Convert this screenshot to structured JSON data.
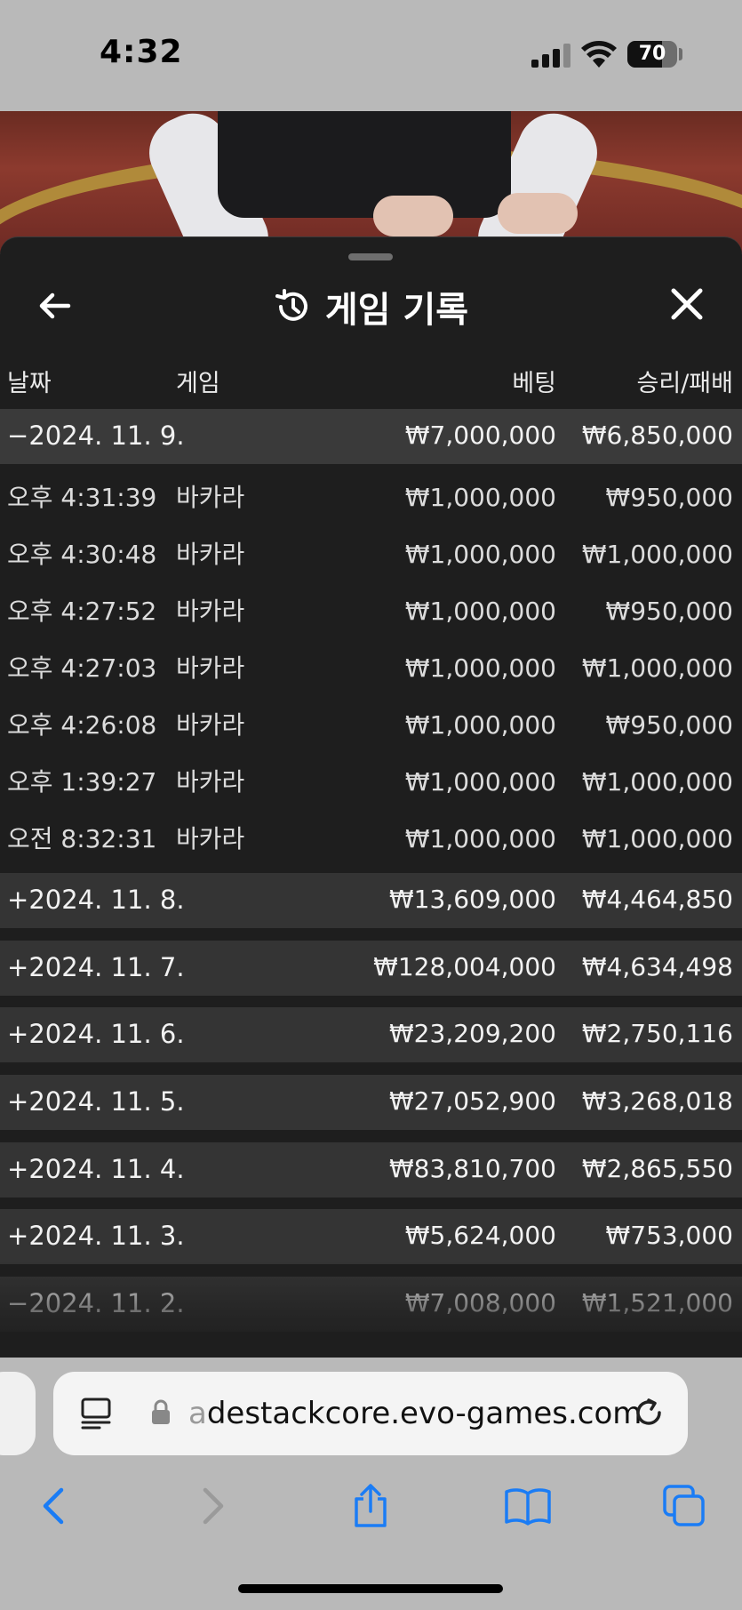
{
  "status_bar": {
    "time": "4:32",
    "battery": "70",
    "battery_level": 0.7
  },
  "panel": {
    "title": "게임 기록"
  },
  "columns": {
    "date": "날짜",
    "game": "게임",
    "bet": "베팅",
    "win_loss": "승리/패배"
  },
  "groups": [
    {
      "toggle": "−",
      "date": "2024. 11. 9.",
      "bet": "₩7,000,000",
      "win": "₩6,850,000",
      "expanded": true,
      "rows": [
        {
          "time": "오후 4:31:39",
          "game": "바카라",
          "bet": "₩1,000,000",
          "win": "₩950,000"
        },
        {
          "time": "오후 4:30:48",
          "game": "바카라",
          "bet": "₩1,000,000",
          "win": "₩1,000,000"
        },
        {
          "time": "오후 4:27:52",
          "game": "바카라",
          "bet": "₩1,000,000",
          "win": "₩950,000"
        },
        {
          "time": "오후 4:27:03",
          "game": "바카라",
          "bet": "₩1,000,000",
          "win": "₩1,000,000"
        },
        {
          "time": "오후 4:26:08",
          "game": "바카라",
          "bet": "₩1,000,000",
          "win": "₩950,000"
        },
        {
          "time": "오후 1:39:27",
          "game": "바카라",
          "bet": "₩1,000,000",
          "win": "₩1,000,000"
        },
        {
          "time": "오전 8:32:31",
          "game": "바카라",
          "bet": "₩1,000,000",
          "win": "₩1,000,000"
        }
      ]
    },
    {
      "toggle": "+",
      "date": "2024. 11. 8.",
      "bet": "₩13,609,000",
      "win": "₩4,464,850"
    },
    {
      "toggle": "+",
      "date": "2024. 11. 7.",
      "bet": "₩128,004,000",
      "win": "₩4,634,498"
    },
    {
      "toggle": "+",
      "date": "2024. 11. 6.",
      "bet": "₩23,209,200",
      "win": "₩2,750,116"
    },
    {
      "toggle": "+",
      "date": "2024. 11. 5.",
      "bet": "₩27,052,900",
      "win": "₩3,268,018"
    },
    {
      "toggle": "+",
      "date": "2024. 11. 4.",
      "bet": "₩83,810,700",
      "win": "₩2,865,550"
    },
    {
      "toggle": "+",
      "date": "2024. 11. 3.",
      "bet": "₩5,624,000",
      "win": "₩753,000"
    },
    {
      "toggle": "−",
      "date": "2024. 11. 2.",
      "bet": "₩7,008,000",
      "win": "₩1,521,000"
    }
  ],
  "browser": {
    "url_faded": "a",
    "url": "destackcore.evo-games.com"
  },
  "colors": {
    "panel_bg": "#1e1e1e",
    "row_header_bg": "#343434",
    "accent_blue": "#1a7cf5"
  }
}
